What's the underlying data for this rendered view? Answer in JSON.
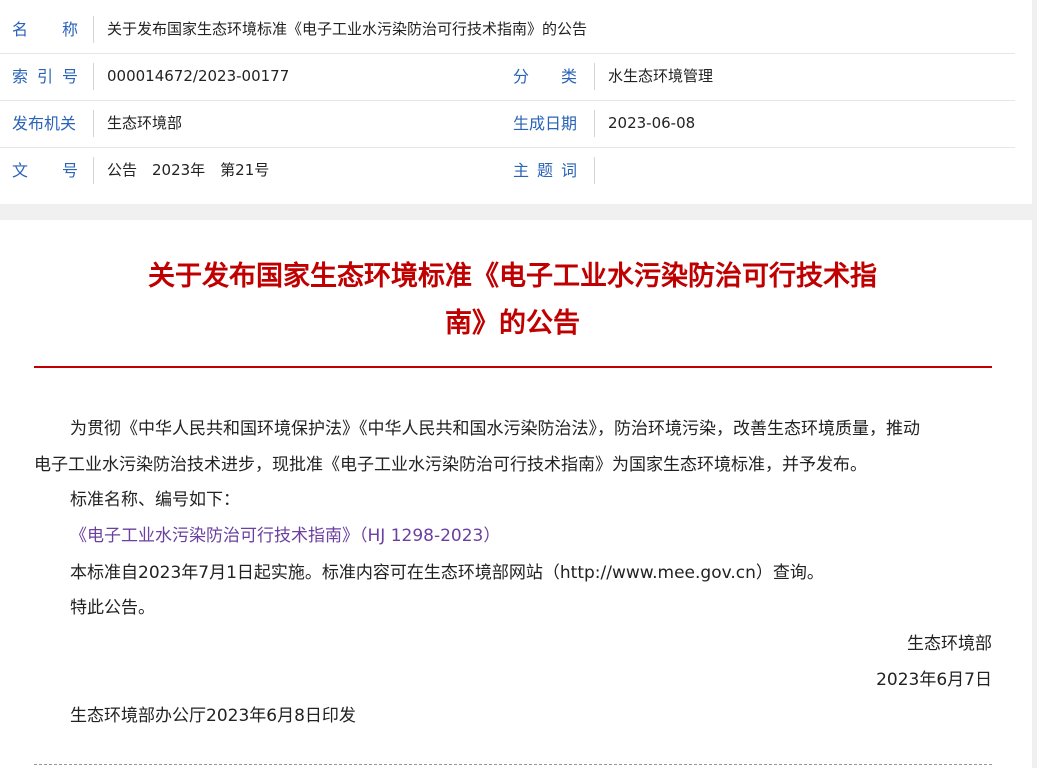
{
  "meta": {
    "name_label": [
      "名",
      "称"
    ],
    "name_value": "关于发布国家生态环境标准《电子工业水污染防治可行技术指南》的公告",
    "index_label": [
      "索",
      "引",
      "号"
    ],
    "index_value": "000014672/2023-00177",
    "category_label": [
      "分",
      "类"
    ],
    "category_value": "水生态环境管理",
    "issuer_label": "发布机关",
    "issuer_value": "生态环境部",
    "date_label": "生成日期",
    "date_value": "2023-06-08",
    "doc_no_label": [
      "文",
      "号"
    ],
    "doc_no_value": "公告　2023年　第21号",
    "subject_label": [
      "主",
      "题",
      "词"
    ],
    "subject_value": ""
  },
  "article": {
    "title_line1": "关于发布国家生态环境标准《电子工业水污染防治可行技术指",
    "title_line2": "南》的公告",
    "para1_line1": "为贯彻《中华人民共和国环境保护法》《中华人民共和国水污染防治法》，防治环境污染，改善生态环境质量，推动",
    "para1_line2": "电子工业水污染防治技术进步，现批准《电子工业水污染防治可行技术指南》为国家生态环境标准，并予发布。",
    "para2": "标准名称、编号如下：",
    "standard_link": "《电子工业水污染防治可行技术指南》（HJ 1298-2023）",
    "para3": "本标准自2023年7月1日起实施。标准内容可在生态环境部网站（http://www.mee.gov.cn）查询。",
    "para4": "特此公告。",
    "signature": "生态环境部",
    "sign_date": "2023年6月7日",
    "footer_note": "生态环境部办公厅2023年6月8日印发"
  },
  "colors": {
    "label_blue": "#2a63b8",
    "title_red": "#c00000",
    "link_purple": "#6b3fa0"
  }
}
